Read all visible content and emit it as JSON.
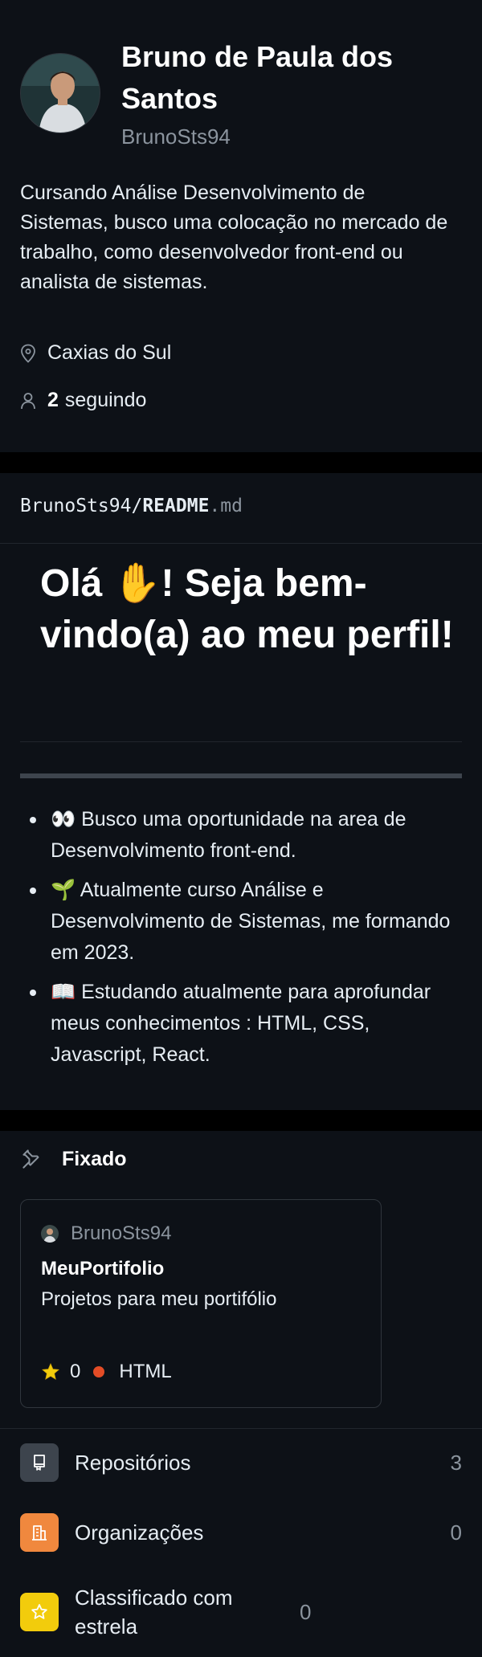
{
  "profile": {
    "name": "Bruno de Paula dos Santos",
    "login": "BrunoSts94",
    "bio": "Cursando Análise Desenvolvimento de Sistemas, busco uma colocação no mercado de trabalho, como desenvolvedor front-end ou analista de sistemas.",
    "location": "Caxias do Sul",
    "following_count": "2",
    "following_label": "seguindo"
  },
  "readme": {
    "path_owner": "BrunoSts94/",
    "path_file": "README",
    "path_ext": ".md",
    "title": "Olá ✋! Seja bem-vindo(a) ao meu perfil!",
    "items": [
      "👀 Busco uma oportunidade na area de Desenvolvimento front-end.",
      "🌱 Atualmente curso Análise e Desenvolvimento de Sistemas, me formando em 2023.",
      "📖 Estudando atualmente para aprofundar meus conhecimentos : HTML, CSS, Javascript, React."
    ]
  },
  "pinned": {
    "heading": "Fixado",
    "card": {
      "owner": "BrunoSts94",
      "repo": "MeuPortifolio",
      "description": "Projetos para meu portifólio",
      "stars": "0",
      "language": "HTML",
      "language_color": "#e34c26"
    }
  },
  "nav": {
    "items": [
      {
        "label": "Repositórios",
        "count": "3",
        "icon": "repo-icon",
        "color": "#3d444d"
      },
      {
        "label": "Organizações",
        "count": "0",
        "icon": "organization-icon",
        "color": "#f0883e"
      },
      {
        "label": "Classificado com estrela",
        "count": "0",
        "icon": "star-icon",
        "color": "#f2cc0c"
      }
    ]
  },
  "colors": {
    "background": "#0d1117",
    "border": "#30363d",
    "muted_text": "#8b949e"
  }
}
